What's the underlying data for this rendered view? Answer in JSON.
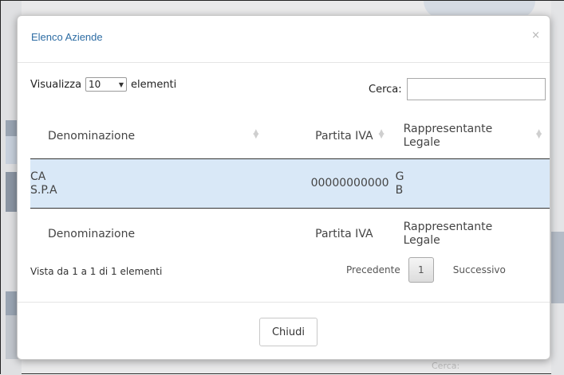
{
  "background": {
    "partial_text": "Cerca:"
  },
  "modal": {
    "title": "Elenco Aziende",
    "close_symbol": "×"
  },
  "controls": {
    "length_prefix": "Visualizza",
    "length_value": "10",
    "length_arrow": "▼",
    "length_suffix": "elementi",
    "search_label": "Cerca:",
    "search_value": ""
  },
  "table": {
    "headers": {
      "denominazione": "Denominazione",
      "partita_iva": "Partita IVA",
      "rappresentante_line1": "Rappresentante",
      "rappresentante_line2": "Legale"
    },
    "rows": [
      {
        "denominazione_line1": "CA",
        "denominazione_line2": "S.P.A",
        "partita_iva": "00000000000",
        "rappresentante_line1": "G",
        "rappresentante_line2": "B",
        "selected": true
      }
    ],
    "footer": {
      "denominazione": "Denominazione",
      "partita_iva": "Partita IVA",
      "rappresentante_line1": "Rappresentante",
      "rappresentante_line2": "Legale"
    }
  },
  "pagination": {
    "info": "Vista da 1 a 1 di 1 elementi",
    "previous": "Precedente",
    "current_page": "1",
    "next": "Successivo"
  },
  "footer": {
    "close_button": "Chiudi"
  },
  "colors": {
    "title": "#2e6da4",
    "selected_row": "#d9e8f7"
  }
}
